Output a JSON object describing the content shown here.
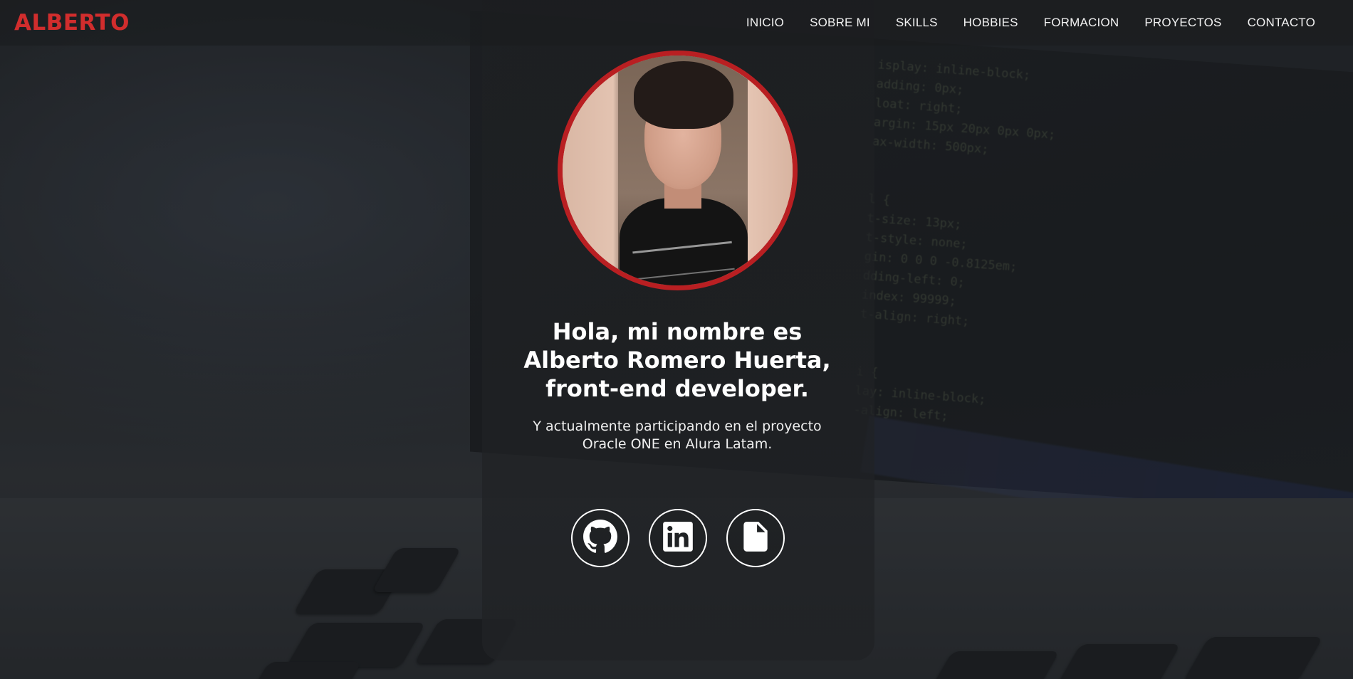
{
  "header": {
    "logo": "ALBERTO",
    "nav": [
      {
        "label": "INICIO"
      },
      {
        "label": "SOBRE MI"
      },
      {
        "label": "SKILLS"
      },
      {
        "label": "HOBBIES"
      },
      {
        "label": "FORMACION"
      },
      {
        "label": "PROYECTOS"
      },
      {
        "label": "CONTACTO"
      }
    ]
  },
  "hero": {
    "title": "Hola, mi nombre es Alberto Romero Huerta, front-end developer.",
    "subtitle": "Y actualmente participando en el proyecto Oracle ONE en Alura Latam."
  },
  "socials": [
    {
      "icon": "github-icon"
    },
    {
      "icon": "linkedin-icon"
    },
    {
      "icon": "document-icon"
    }
  ],
  "colors": {
    "accent": "#d12d2d",
    "avatar_border": "#b91f22",
    "text": "#ffffff"
  }
}
